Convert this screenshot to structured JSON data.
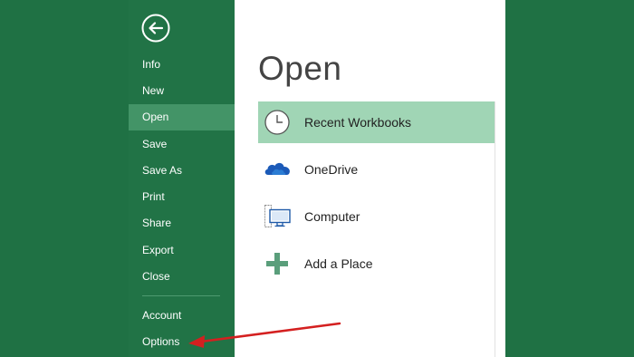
{
  "sidebar": {
    "back_label": "Back",
    "items": [
      {
        "label": "Info"
      },
      {
        "label": "New"
      },
      {
        "label": "Open"
      },
      {
        "label": "Save"
      },
      {
        "label": "Save As"
      },
      {
        "label": "Print"
      },
      {
        "label": "Share"
      },
      {
        "label": "Export"
      },
      {
        "label": "Close"
      },
      {
        "label": "Account"
      },
      {
        "label": "Options"
      }
    ],
    "active_item": "Open"
  },
  "main": {
    "title": "Open",
    "locations": [
      {
        "label": "Recent Workbooks",
        "icon": "clock-icon",
        "selected": true
      },
      {
        "label": "OneDrive",
        "icon": "cloud-icon",
        "selected": false
      },
      {
        "label": "Computer",
        "icon": "computer-icon",
        "selected": false
      },
      {
        "label": "Add a Place",
        "icon": "plus-icon",
        "selected": false
      }
    ]
  },
  "annotation": {
    "arrow_target": "Options",
    "arrow_color": "#d42020"
  },
  "colors": {
    "backstage_green": "#217346",
    "selected_nav": "#439467",
    "selected_location": "#a0d5b5"
  }
}
